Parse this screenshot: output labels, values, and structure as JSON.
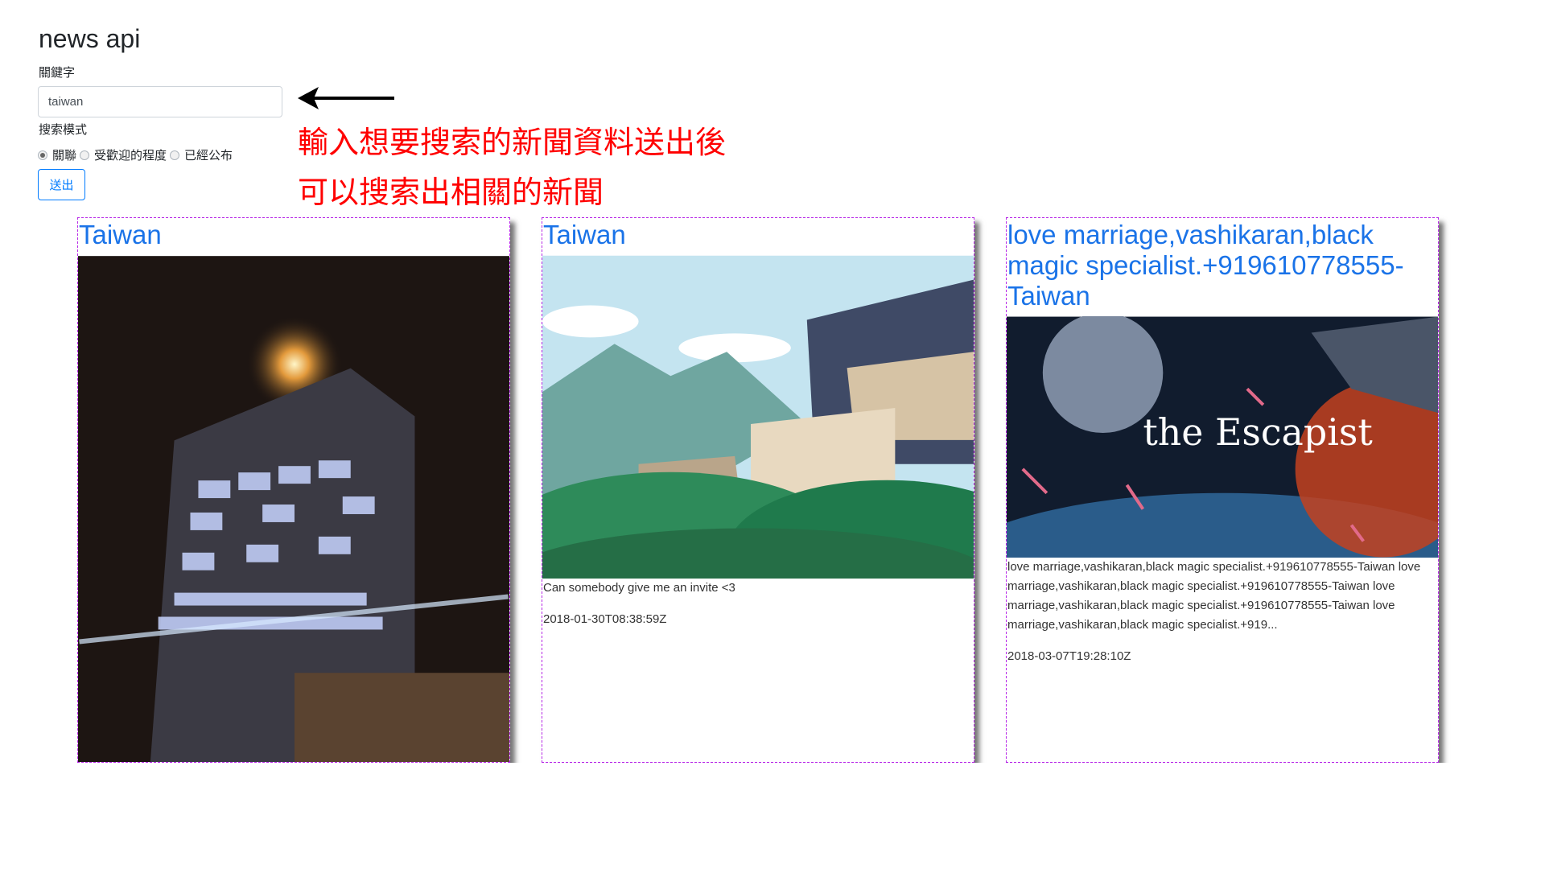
{
  "app": {
    "title": "news api"
  },
  "form": {
    "keyword_label": "關鍵字",
    "keyword_value": "taiwan",
    "mode_label": "搜索模式",
    "modes": [
      {
        "label": "關聯",
        "checked": true
      },
      {
        "label": "受歡迎的程度",
        "checked": false
      },
      {
        "label": "已經公布",
        "checked": false
      }
    ],
    "submit_label": "送出"
  },
  "annotation": {
    "line1": "輸入想要搜索的新聞資料送出後",
    "line2": "可以搜索出相關的新聞",
    "color": "#ff0000"
  },
  "cards": [
    {
      "title": "Taiwan",
      "description": "",
      "date": "",
      "image": "night-building-photo"
    },
    {
      "title": "Taiwan",
      "description": "Can somebody give me an invite <3",
      "date": "2018-01-30T08:38:59Z",
      "image": "hillside-town-illustration"
    },
    {
      "title": "love marriage,vashikaran,black magic specialist.+919610778555-Taiwan",
      "description": "love marriage,vashikaran,black magic specialist.+919610778555-Taiwan love marriage,vashikaran,black magic specialist.+919610778555-Taiwan love marriage,vashikaran,black magic specialist.+919610778555-Taiwan love marriage,vashikaran,black magic specialist.+919...",
      "date": "2018-03-07T19:28:10Z",
      "image": "the-escapist-space-art",
      "image_text": "the Escapist"
    }
  ],
  "colors": {
    "link": "#1a73e8",
    "card_border": "#b829e8",
    "button": "#007bff"
  }
}
